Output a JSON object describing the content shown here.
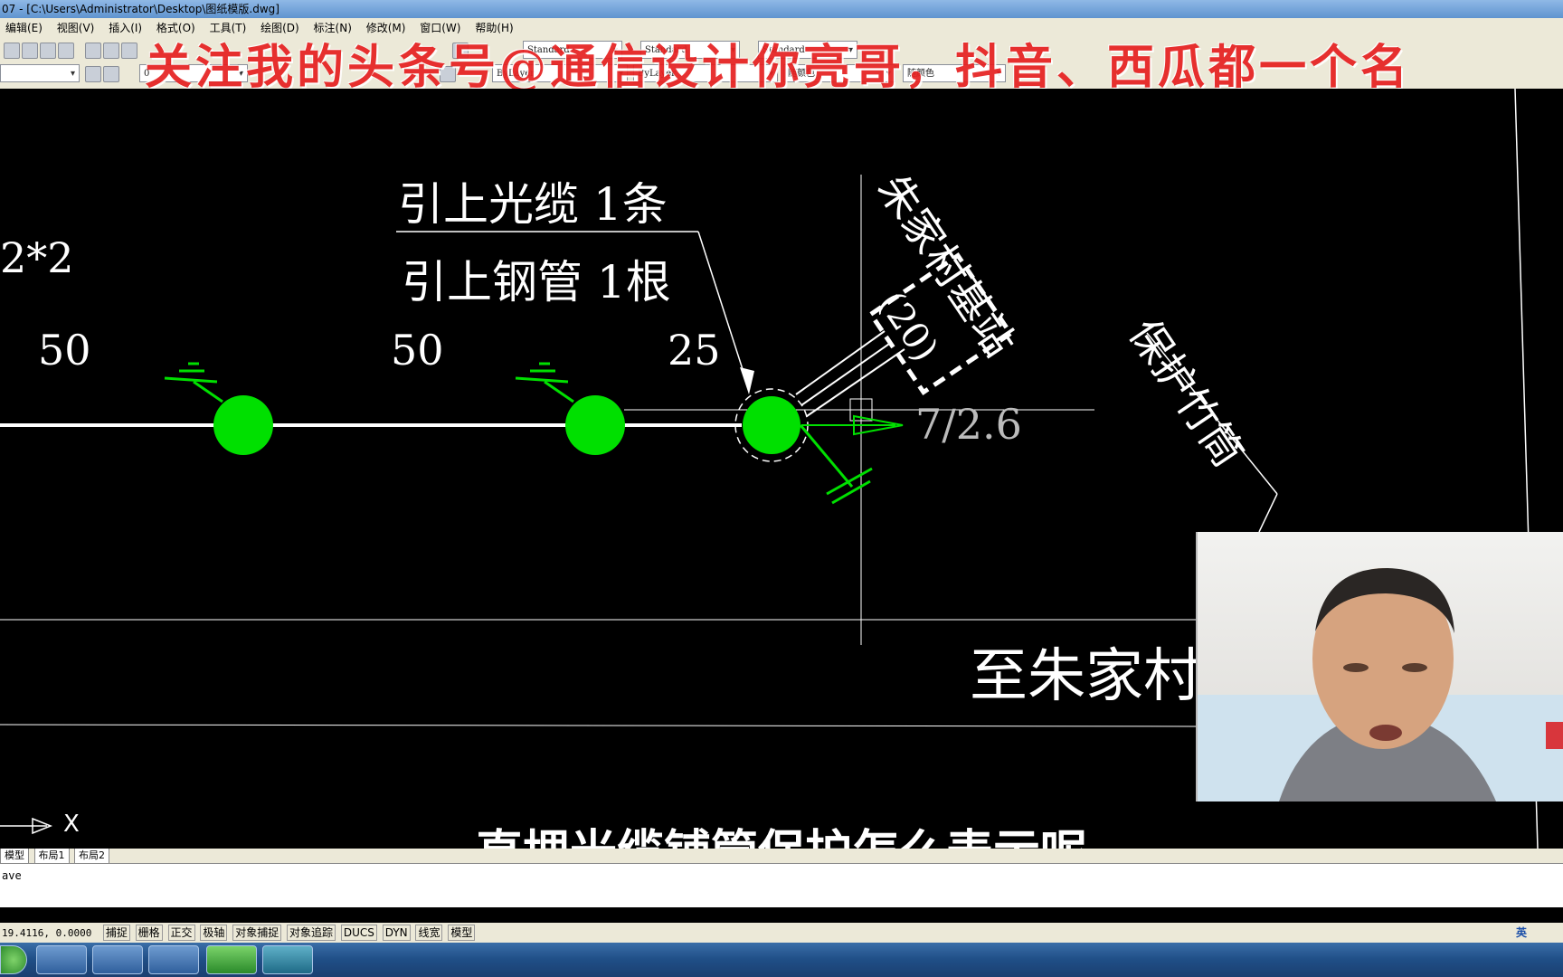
{
  "window": {
    "title": "07 - [C:\\Users\\Administrator\\Desktop\\图纸模版.dwg]"
  },
  "menu": [
    "编辑(E)",
    "视图(V)",
    "插入(I)",
    "格式(O)",
    "工具(T)",
    "绘图(D)",
    "标注(N)",
    "修改(M)",
    "窗口(W)",
    "帮助(H)"
  ],
  "toolbar": {
    "text_style": "Standard",
    "dim_style": "Standard",
    "table_style": "Standard",
    "layer": "0",
    "color": "ByLayer",
    "linetype": "ByLayer",
    "lineweight": "随颜色",
    "plot_style": "随颜色"
  },
  "watermark": "关注我的头条号@通信设计你亮哥，抖音、西瓜都一个名",
  "drawing": {
    "label_cable": "引上光缆 1条",
    "label_pipe": "引上钢管 1根",
    "label_2x2": "2*2",
    "dist1": "50",
    "dist2": "50",
    "dist3": "25",
    "spec": "7/2.6",
    "station": "朱家村基站",
    "station_num": "(20)",
    "bamboo": "保护竹筒",
    "to_village": "至朱家村"
  },
  "axis_label": "X",
  "layout_tabs": [
    "模型",
    "布局1",
    "布局2"
  ],
  "command_text": "ave",
  "status": {
    "coords": "19.4116, 0.0000",
    "buttons": [
      "捕捉",
      "栅格",
      "正交",
      "极轴",
      "对象捕捉",
      "对象追踪",
      "DUCS",
      "DYN",
      "线宽",
      "模型"
    ]
  },
  "subtitle": "直埋光缆铺管保护怎么表示呢",
  "tray": {
    "ime": "英"
  }
}
